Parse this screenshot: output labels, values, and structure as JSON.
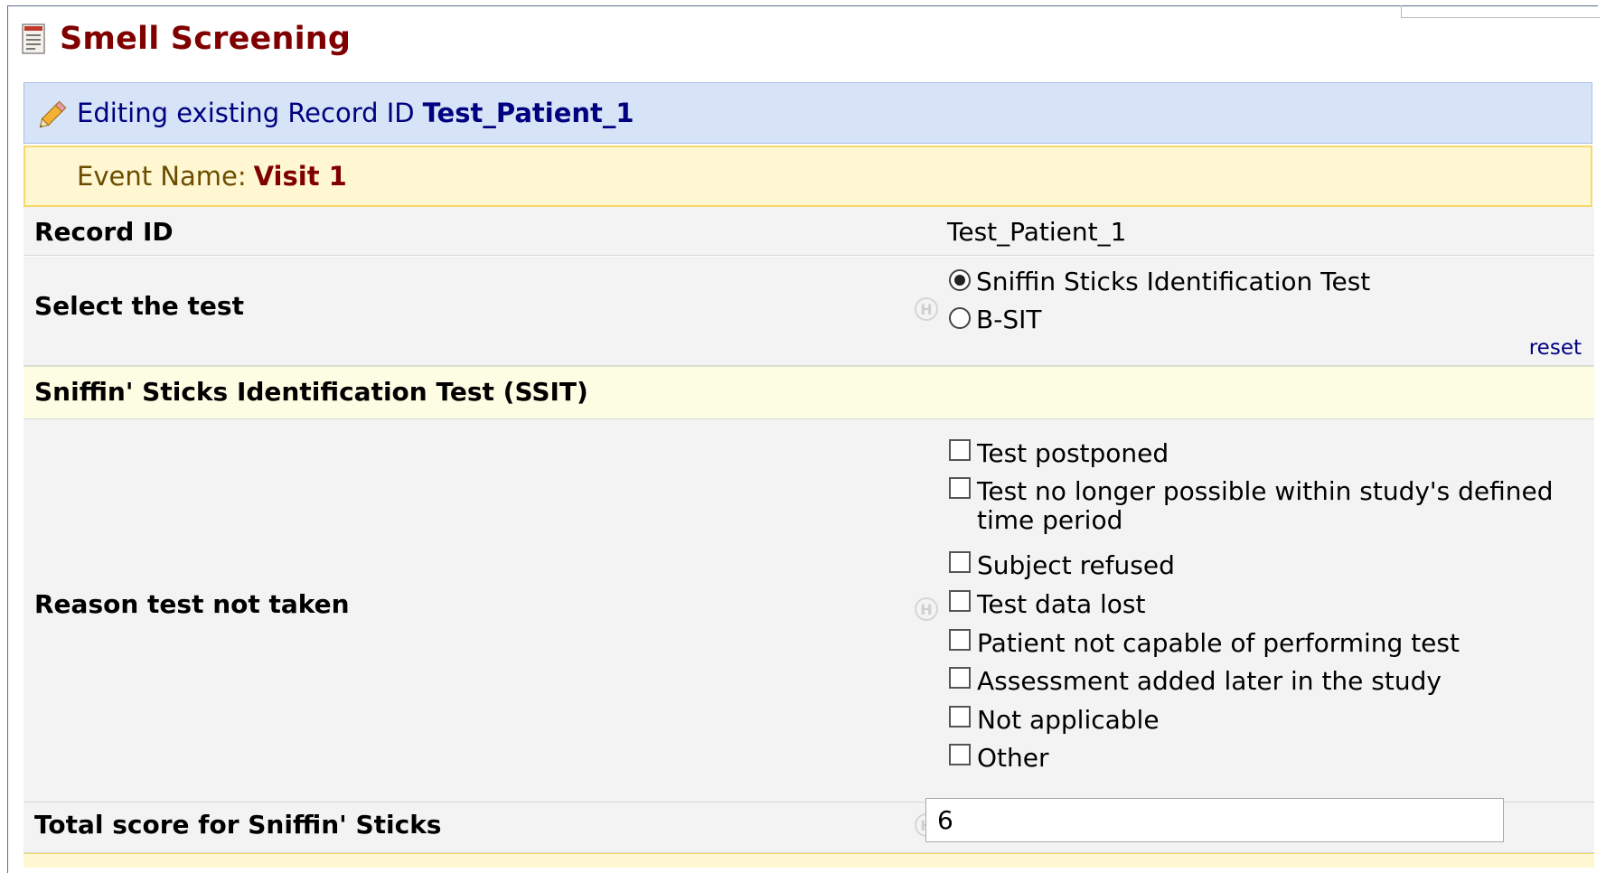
{
  "form": {
    "title": "Smell Screening"
  },
  "edit_banner": {
    "prefix": "Editing existing Record ID",
    "record_id": "Test_Patient_1"
  },
  "event_banner": {
    "label": "Event Name:",
    "event_name": "Visit 1"
  },
  "fields": {
    "record_id": {
      "label": "Record ID",
      "value": "Test_Patient_1"
    },
    "select_test": {
      "label": "Select the test",
      "options": [
        "Sniffin Sticks Identification Test",
        "B-SIT"
      ],
      "selected": "Sniffin Sticks Identification Test",
      "reset_label": "reset",
      "hint_icon": "H"
    },
    "section": {
      "title": "Sniffin' Sticks Identification Test (SSIT)"
    },
    "reason": {
      "label": "Reason test not taken",
      "hint_icon": "H",
      "options": [
        "Test postponed",
        "Test no longer possible within study's defined time period",
        "Subject refused",
        "Test data lost",
        "Patient not capable of performing test",
        "Assessment added later in the study",
        "Not applicable",
        "Other"
      ]
    },
    "total_score": {
      "label": "Total score for Sniffin' Sticks",
      "value": "6",
      "hint_icon": "H"
    }
  },
  "colors": {
    "title": "#800000",
    "edit_banner_bg": "#d7e3f6",
    "event_banner_bg": "#fff7d1",
    "section_bg": "#fdfde4",
    "link": "#000080"
  },
  "icons": {
    "form_icon": "form-document-icon",
    "edit_icon": "pencil-icon"
  }
}
